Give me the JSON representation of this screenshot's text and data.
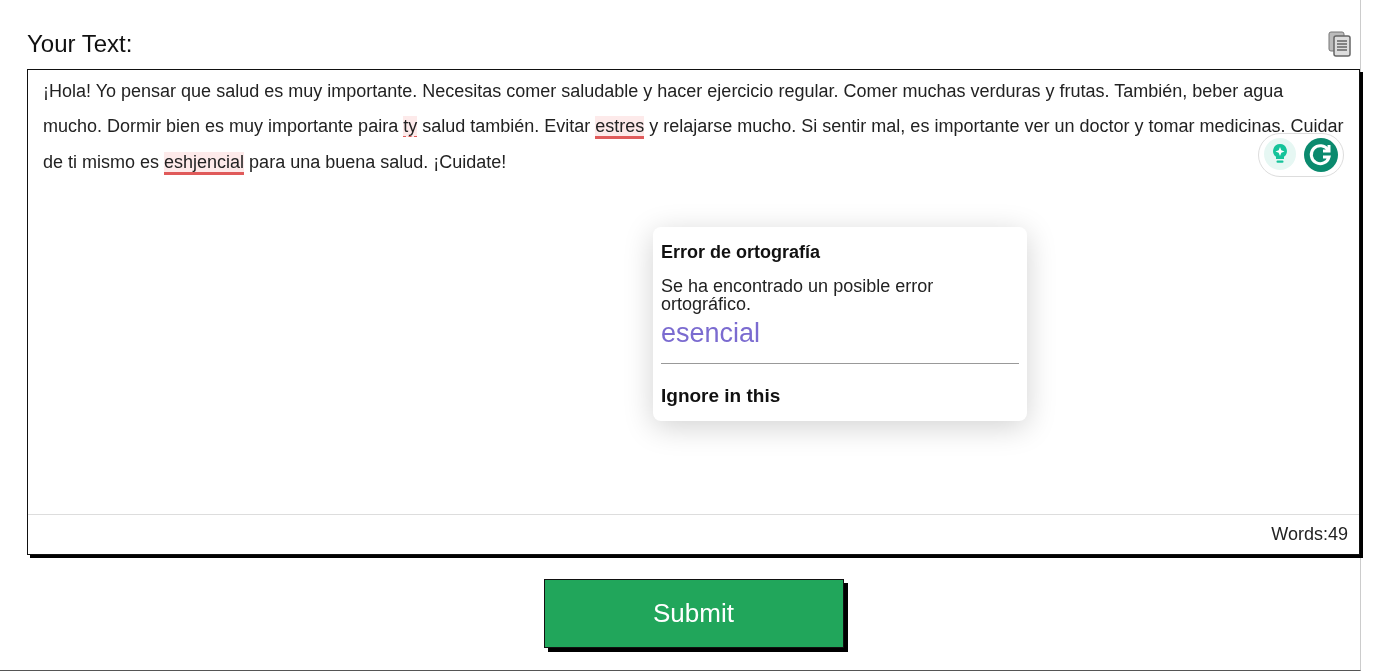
{
  "heading": "Your Text:",
  "editor": {
    "segments": [
      {
        "text": "¡Hola! Yo pensar que salud es muy importante. Necesitas comer saludable y hacer ejercicio regular. Comer muchas verduras y frutas. También, beber agua mucho. Dormir bien es muy importante paira ",
        "kind": "plain"
      },
      {
        "text": "ty",
        "kind": "hint"
      },
      {
        "text": " salud también. Evitar ",
        "kind": "plain"
      },
      {
        "text": "estres",
        "kind": "error"
      },
      {
        "text": " y relajarse mucho. Si sentir mal, es importante ver un doctor y tomar medicinas. Cuidar de ti mismo es ",
        "kind": "plain"
      },
      {
        "text": "eshjencial",
        "kind": "error"
      },
      {
        "text": " para una buena salud. ¡Cuidate!",
        "kind": "plain"
      }
    ],
    "word_count": "Words:49"
  },
  "suggestion": {
    "title": "Error de ortografía",
    "message": "Se ha encontrado un posible error ortográfico.",
    "replacement": "esencial",
    "action": "Ignore in this"
  },
  "submit": "Submit"
}
